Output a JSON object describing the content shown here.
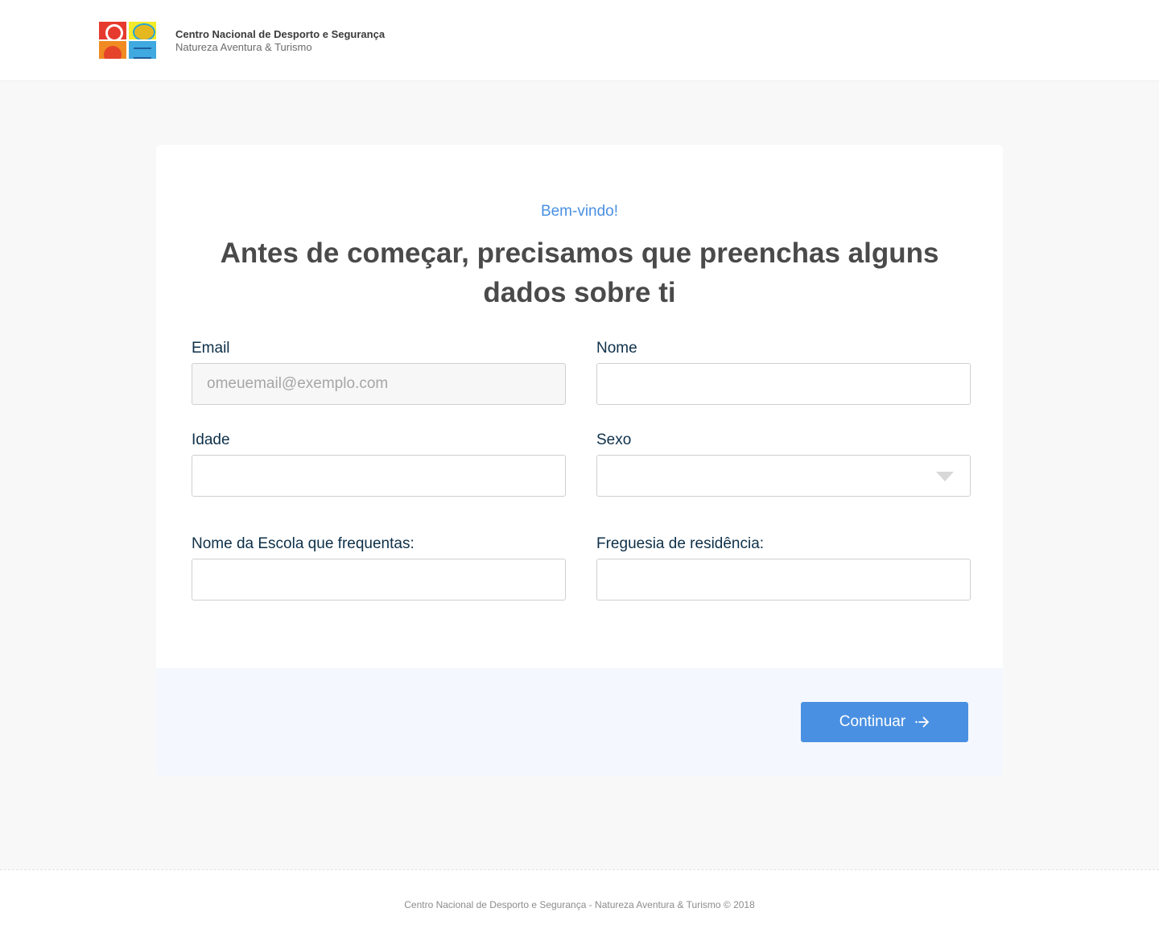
{
  "header": {
    "brand_title": "Centro Nacional de Desporto e Segurança",
    "brand_subtitle": "Natureza Aventura & Turismo"
  },
  "form": {
    "welcome": "Bem-vindo!",
    "headline": "Antes de começar, precisamos que preenchas alguns dados sobre ti",
    "email": {
      "label": "Email",
      "placeholder": "omeuemail@exemplo.com",
      "value": ""
    },
    "nome": {
      "label": "Nome",
      "value": ""
    },
    "idade": {
      "label": "Idade",
      "value": ""
    },
    "sexo": {
      "label": "Sexo",
      "selected": ""
    },
    "escola": {
      "label": "Nome da Escola que frequentas:",
      "value": ""
    },
    "freguesia": {
      "label": "Freguesia de residência:",
      "value": ""
    },
    "continue_label": "Continuar"
  },
  "footer": {
    "text": "Centro Nacional de Desporto e Segurança - Natureza Aventura & Turismo © 2018"
  },
  "colors": {
    "accent": "#4a90e2",
    "label": "#0e3049",
    "footer_band": "#f4f8fe"
  }
}
